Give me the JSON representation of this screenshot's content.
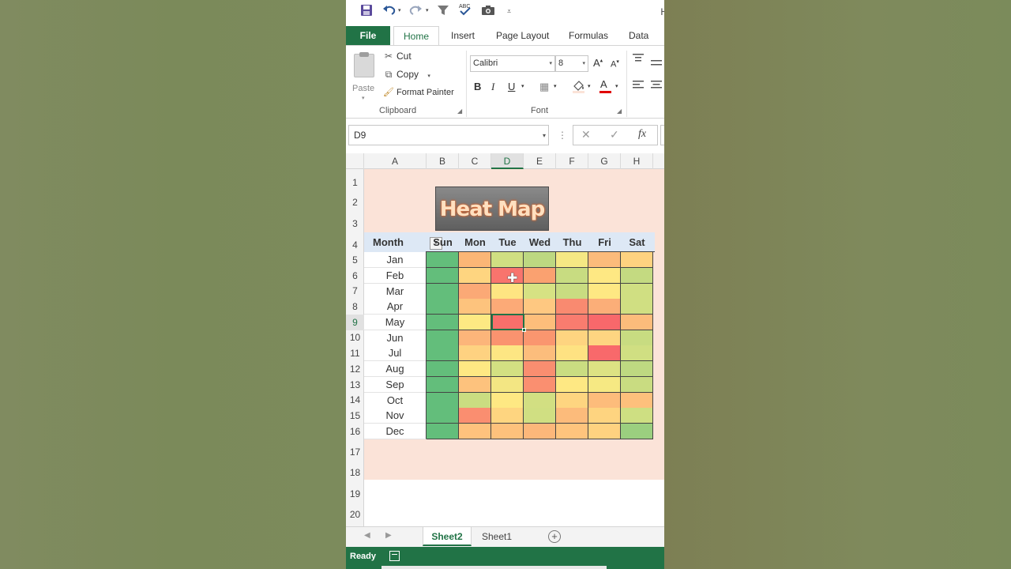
{
  "app": {
    "window_title_fragment": "H",
    "quick_access": [
      "save-icon",
      "undo-icon",
      "redo-icon",
      "filter-icon",
      "spelling-icon",
      "camera-icon",
      "customize-icon"
    ]
  },
  "ribbon": {
    "tabs": [
      "File",
      "Home",
      "Insert",
      "Page Layout",
      "Formulas",
      "Data"
    ],
    "active_tab": "Home",
    "clipboard": {
      "paste_label": "Paste",
      "cut_label": "Cut",
      "copy_label": "Copy",
      "format_painter_label": "Format Painter",
      "group_label": "Clipboard"
    },
    "font": {
      "font_name": "Calibri",
      "font_size": "8",
      "bold_label": "B",
      "italic_label": "I",
      "underline_label": "U",
      "grow_label": "A",
      "shrink_label": "A",
      "font_color_label": "A",
      "group_label": "Font"
    }
  },
  "formula_bar": {
    "name_box": "D9",
    "fx_label": "fx",
    "value": ""
  },
  "grid": {
    "columns": [
      "A",
      "B",
      "C",
      "D",
      "E",
      "F",
      "G",
      "H"
    ],
    "selected_column": "D",
    "rows": [
      "1",
      "2",
      "3",
      "4",
      "5",
      "6",
      "7",
      "8",
      "9",
      "10",
      "11",
      "12",
      "13",
      "14",
      "15",
      "16",
      "17",
      "18",
      "19",
      "20"
    ],
    "selected_row": "9",
    "selected_cell": "D9"
  },
  "heat_map": {
    "title": "Heat Map",
    "header_month": "Month",
    "days": [
      "Sun",
      "Mon",
      "Tue",
      "Wed",
      "Thu",
      "Fri",
      "Sat"
    ],
    "months": [
      "Jan",
      "Feb",
      "Mar",
      "Apr",
      "May",
      "Jun",
      "Jul",
      "Aug",
      "Sep",
      "Oct",
      "Nov",
      "Dec"
    ],
    "cell_colors": [
      [
        "#63be7b",
        "#fbb676",
        "#d0df82",
        "#bdd881",
        "#f5e884",
        "#fcbb7b",
        "#fed280"
      ],
      [
        "#63be7b",
        "#fed580",
        "#f8746d",
        "#faa170",
        "#c8dc81",
        "#fee883",
        "#c4da81"
      ],
      [
        "#63be7b",
        "#fba976",
        "#fee582",
        "#d6e283",
        "#c9dc81",
        "#fee883",
        "#d0df82"
      ],
      [
        "#63be7b",
        "#fdc37d",
        "#fcaa77",
        "#fec881",
        "#f98a70",
        "#fbae78",
        "#d0df82"
      ],
      [
        "#63be7b",
        "#fde983",
        "#f96f6b",
        "#fdbe7b",
        "#f97c6f",
        "#f8686b",
        "#fcbc7b"
      ],
      [
        "#63be7b",
        "#fcb57a",
        "#fa936f",
        "#fa966f",
        "#fed480",
        "#fed581",
        "#c8dc81"
      ],
      [
        "#63be7b",
        "#fed281",
        "#fde683",
        "#fcbd7c",
        "#fee282",
        "#f8696b",
        "#d0df82"
      ],
      [
        "#63be7b",
        "#fee883",
        "#d3e082",
        "#f98e70",
        "#cadd81",
        "#dde283",
        "#bed981"
      ],
      [
        "#63be7b",
        "#fdc27d",
        "#f3e683",
        "#fa8f70",
        "#fee883",
        "#f6e983",
        "#c9dc81"
      ],
      [
        "#63be7b",
        "#cadd81",
        "#fee883",
        "#d2df82",
        "#fed580",
        "#fdbc7b",
        "#fdc07c"
      ],
      [
        "#63be7b",
        "#fa8e70",
        "#fed580",
        "#d0df82",
        "#fcbb7b",
        "#fed480",
        "#cedf82"
      ],
      [
        "#63be7b",
        "#fec27d",
        "#fdc17c",
        "#fcb77a",
        "#fec47d",
        "#fed280",
        "#9bcf7f"
      ]
    ]
  },
  "sheets": {
    "tabs": [
      "Sheet2",
      "Sheet1"
    ],
    "active": "Sheet2"
  },
  "status": {
    "ready_label": "Ready"
  },
  "colors": {
    "excel_green": "#217346",
    "sheet_background": "#fbe3d8",
    "header_band": "#dde8f5"
  }
}
